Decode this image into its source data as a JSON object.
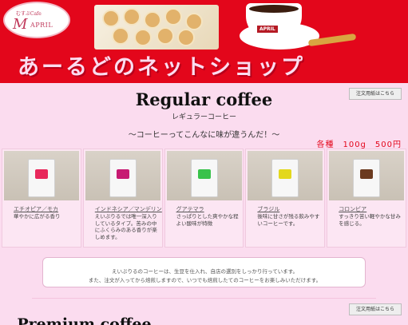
{
  "header": {
    "logo_small": "むすぶCafe",
    "logo_big": "M",
    "logo_april": "APRIL",
    "cup_label": "APRIL",
    "shop_title": "あーるどのネットショップ"
  },
  "order_button_label": "注文用紙はこちら",
  "regular": {
    "title": "Regular coffee",
    "subtitle": "レギュラーコーヒー",
    "tagline": "〜コーヒーってこんなに味が違うんだ！〜",
    "price": "各種　100g　500円"
  },
  "products": [
    {
      "name": "エチオピア／モカ",
      "desc": "華やかに広がる香り",
      "label_color": "#e8285b"
    },
    {
      "name": "インドネシア／マンデリン",
      "desc": "えいぷりるでは唯一深入りしているタイプ。苦みの中にふくらみのある香りが楽しめます。",
      "label_color": "#c71a72"
    },
    {
      "name": "グアテマラ",
      "desc": "さっぱりとした爽やかな程よい酸味が特徴",
      "label_color": "#39c24a"
    },
    {
      "name": "ブラジル",
      "desc": "後味に甘さが残る飲みやすいコーヒーです。",
      "label_color": "#e3d81c"
    },
    {
      "name": "コロンビア",
      "desc": "すっきり苦い軽やかな甘みを感じる。",
      "label_color": "#6b3a1f"
    }
  ],
  "notice": {
    "line1": "えいぷりるのコーヒーは、生豆を仕入れ、自店の選別をしっかり行っています。",
    "line2": "また、注文が入ってから焙煎しますので、いつでも焙煎したてのコーヒーをお楽しみいただけます。"
  },
  "premium": {
    "title": "Premium coffee"
  }
}
